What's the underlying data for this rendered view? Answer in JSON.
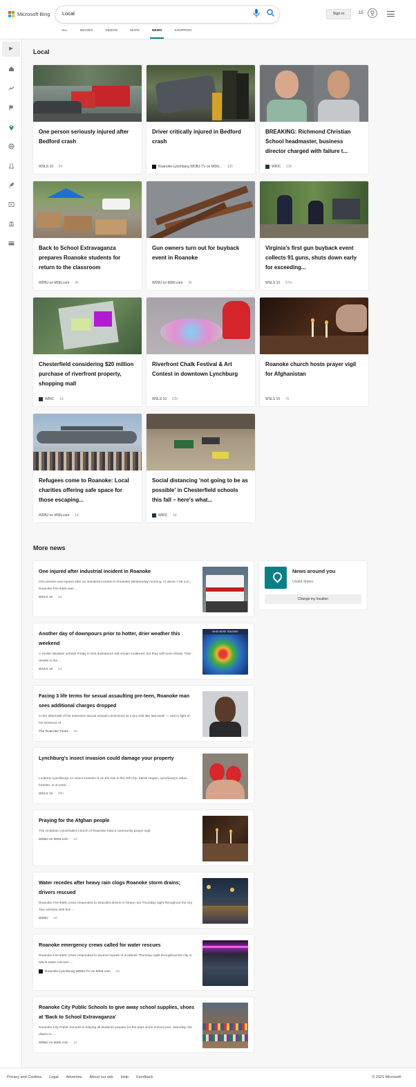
{
  "brand": {
    "logo_text": "Microsoft Bing",
    "colors": [
      "#f25022",
      "#7fba00",
      "#00a4ef",
      "#ffb900"
    ]
  },
  "search": {
    "query": "Local"
  },
  "header": {
    "signin_label": "Sign in",
    "rewards_count": "15"
  },
  "tabs": [
    {
      "label": "ALL",
      "active": false
    },
    {
      "label": "IMAGES",
      "active": false
    },
    {
      "label": "VIDEOS",
      "active": false
    },
    {
      "label": "MAPS",
      "active": false
    },
    {
      "label": "NEWS",
      "active": true
    },
    {
      "label": "SHOPPING",
      "active": false
    }
  ],
  "sidebar": {
    "icons": [
      "home-icon",
      "trending-icon",
      "flag-icon",
      "location-icon",
      "globe-icon",
      "science-icon",
      "rocket-icon",
      "video-icon",
      "bank-icon",
      "card-icon"
    ],
    "active": "location-icon",
    "accent": "#0a7f86"
  },
  "local": {
    "title": "Local",
    "cards": [
      {
        "title": "One person seriously injured after Bedford crash",
        "source": "WSLS 10",
        "age": "9h",
        "has_logo": false
      },
      {
        "title": "Driver critically injured in Bedford crash",
        "source": "Roanoke-Lynchburg WDBJ-TV on MSN...",
        "age": "12h",
        "has_logo": true
      },
      {
        "title": "BREAKING: Richmond Christian School headmaster, business director charged with failure t...",
        "source": "WRIC",
        "age": "13h",
        "has_logo": true
      },
      {
        "title": "Back to School Extravaganza prepares Roanoke students for return to the classroom",
        "source": "WDBJ on MSN.com",
        "age": "2h",
        "has_logo": false
      },
      {
        "title": "Gun owners turn out for buyback event in Roanoke",
        "source": "WDBJ on MSN.com",
        "age": "3h",
        "has_logo": false
      },
      {
        "title": "Virginia's first gun buyback event collects 91 guns, shuts down early for exceeding...",
        "source": "WSLS 10",
        "age": "37m",
        "has_logo": false
      },
      {
        "title": "Chesterfield considering $20 million purchase of riverfront property, shopping mall",
        "source": "WRIC",
        "age": "1d",
        "has_logo": true
      },
      {
        "title": "Riverfront Chalk Festival & Art Contest in downtown Lynchburg",
        "source": "WSLS 10",
        "age": "22h",
        "has_logo": false
      },
      {
        "title": "Roanoke church hosts prayer vigil for Afghanistan",
        "source": "WSLS 10",
        "age": "7h",
        "has_logo": false
      },
      {
        "title": "Refugees come to Roanoke: Local charities offering safe space for those escaping...",
        "source": "WDBJ on MSN.com",
        "age": "1d",
        "has_logo": false
      },
      {
        "title": "Social distancing 'not going to be as possible' in Chesterfield schools this fall – here's what...",
        "source": "WRIC",
        "age": "1d",
        "has_logo": true
      }
    ]
  },
  "more_news": {
    "title": "More news",
    "items": [
      {
        "title": "One injured after industrial incident in Roanoke",
        "snippet": "One person was injured after an industrial incident in Roanoke Wednesday morning. At about 7:45 a.m., Roanoke Fire-EMS was ...",
        "source": "WSLS 10",
        "age": "2d",
        "has_logo": false
      },
      {
        "title": "Another day of downpours prior to hotter, drier weather this weekend",
        "snippet": "A similar situation unfolds Friday in that downpours will remain scattered, but they will move slowly. That results in the ...",
        "source": "WSLS 10",
        "age": "1d",
        "has_logo": false
      },
      {
        "title": "Facing 3 life terms for sexual assaulting pre-teen, Roanoke man sees additional charges dropped",
        "snippet": "In the aftermath of his extensive sexual assault convictions at a jury trial late last week — and in light of his sentence of ...",
        "source": "The Roanoke Times",
        "age": "2d",
        "has_logo": false
      },
      {
        "title": "Lynchburg's insect invasion could damage your property",
        "snippet": "Lookout, Lynchburg! An insect invasion is on the rise in the Hill City. Sarah Hagan, Lynchburg's urban forester, is on pest ...",
        "source": "WSLS 10",
        "age": "20h",
        "has_logo": false
      },
      {
        "title": "Praying for the Afghan people",
        "snippet": "The Unitarian Universalist Church of Roanoke held a community prayer vigil.",
        "source": "WDBJ on MSN.com",
        "age": "1d",
        "has_logo": false
      },
      {
        "title": "Water recedes after heavy rain clogs Roanoke storm drains; drivers rescued",
        "snippet": "Roanoke Fire-EMS crews responded to stranded drivers in heavy rain Thursday night throughout the city. Two vehicles with five ...",
        "source": "WDBJ",
        "age": "2d",
        "has_logo": false
      },
      {
        "title": "Roanoke emergency crews called for water rescues",
        "snippet": "Roanoke Fire-EMS crews responded to several reports of incidents Thursday night throughout the city in which water rescues ...",
        "source": "Roanoke-Lynchburg WDBJ-TV on MSN.com",
        "age": "2d",
        "has_logo": true
      },
      {
        "title": "Roanoke City Public Schools to give away school supplies, shoes at 'Back to School Extravaganza'",
        "snippet": "Roanoke City Public Schools is helping all students prepare for the start of the school year. Saturday, the district is ...",
        "source": "WDBJ on MSN.com",
        "age": "1d",
        "has_logo": false
      }
    ]
  },
  "news_around": {
    "title": "News around you",
    "subtitle": "United States",
    "button_label": "Change my location"
  },
  "thumb_text": {
    "weather_banner": "WHAT WE'RE TRACKING"
  },
  "footer": {
    "links": [
      "Privacy and Cookies",
      "Legal",
      "Advertise",
      "About our ads",
      "Help",
      "Feedback"
    ],
    "copyright": "© 2021 Microsoft"
  }
}
